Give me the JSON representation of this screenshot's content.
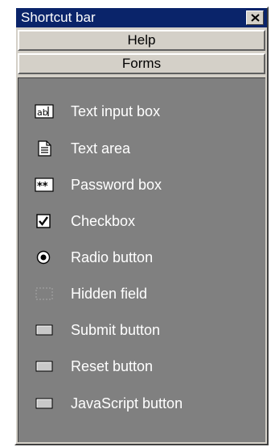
{
  "window": {
    "title": "Shortcut bar",
    "close_label": "Close"
  },
  "sections": [
    {
      "label": "Help"
    },
    {
      "label": "Forms"
    }
  ],
  "forms": {
    "items": [
      {
        "label": "Text input box",
        "icon": "text-input-icon"
      },
      {
        "label": "Text area",
        "icon": "text-area-icon"
      },
      {
        "label": "Password box",
        "icon": "password-icon"
      },
      {
        "label": "Checkbox",
        "icon": "checkbox-icon"
      },
      {
        "label": "Radio button",
        "icon": "radio-button-icon"
      },
      {
        "label": "Hidden field",
        "icon": "hidden-field-icon"
      },
      {
        "label": "Submit button",
        "icon": "submit-button-icon"
      },
      {
        "label": "Reset button",
        "icon": "reset-button-icon"
      },
      {
        "label": "JavaScript button",
        "icon": "javascript-button-icon"
      }
    ]
  },
  "colors": {
    "titlebar": "#0a246a",
    "panel": "#d4d0c8",
    "content": "#808080",
    "label_text": "#ffffff"
  }
}
